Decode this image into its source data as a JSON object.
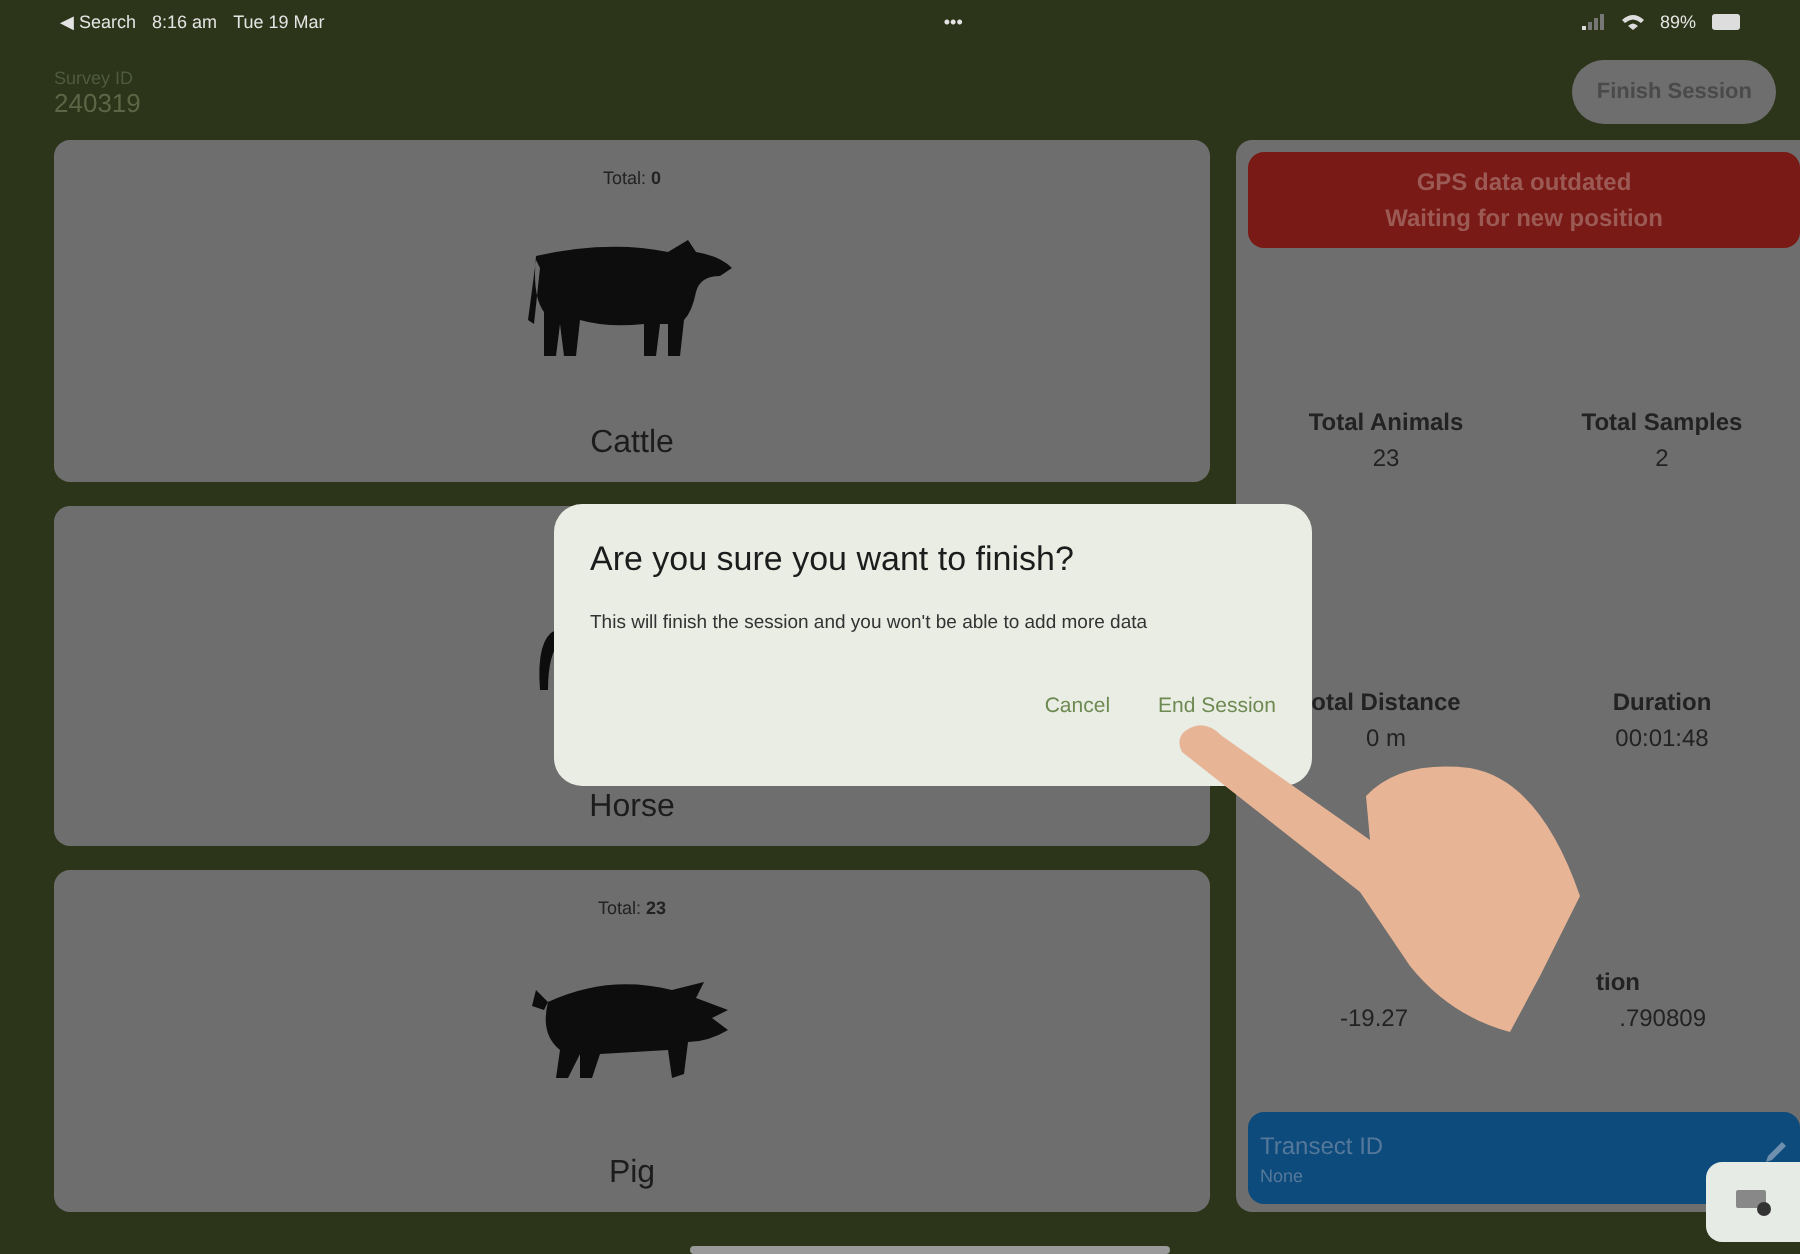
{
  "status_bar": {
    "back": "◀ Search",
    "time": "8:16 am",
    "date": "Tue 19 Mar",
    "dots": "•••",
    "battery": "89%"
  },
  "header": {
    "label": "Survey ID",
    "value": "240319",
    "button": "Finish Session"
  },
  "animals": [
    {
      "kind": "cattle",
      "name": "Cattle",
      "total": "Total: **0**"
    },
    {
      "kind": "horse",
      "name": "Horse"
    },
    {
      "kind": "pig",
      "name": "Pig",
      "total": "Total: **23**"
    }
  ],
  "gps_alert": {
    "lines": [
      "GPS data outdated",
      "Waiting for new position"
    ]
  },
  "stats": [
    {
      "label": "Total Animals",
      "value": "23"
    },
    {
      "label": "Total Samples",
      "value": "2"
    },
    {
      "label": "otal Distance",
      "value": "0 m"
    },
    {
      "label": "Duration",
      "value": "00:01:48"
    }
  ],
  "location": {
    "label": "tion",
    "value_start": "-19.27",
    "value_end": ".790809"
  },
  "transect": {
    "label": "Transect ID",
    "value": "None"
  },
  "dialog": {
    "title": "Are you sure you want to finish?",
    "message": "This will finish the session and you won't be able to add more data",
    "buttons": [
      "Cancel",
      "End Session"
    ]
  }
}
